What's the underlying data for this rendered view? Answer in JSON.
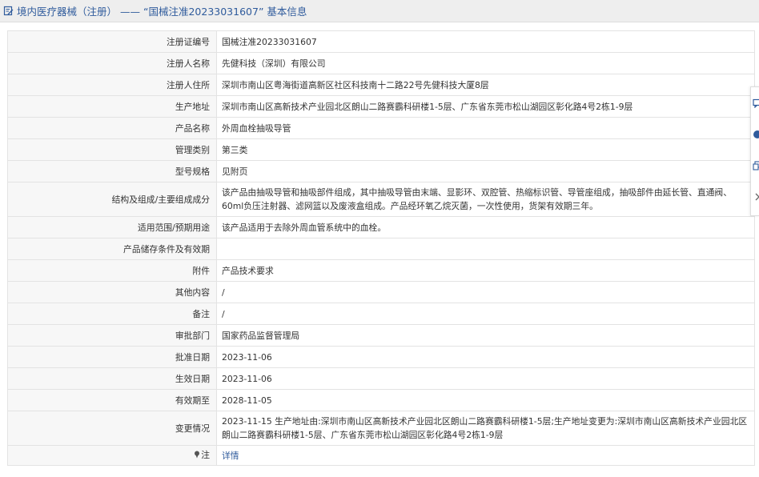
{
  "header": {
    "section": "境内医疗器械（注册）",
    "separator": "——",
    "record_title": "“国械注准20233031607” 基本信息"
  },
  "rows": [
    {
      "label": "注册证编号",
      "value": "国械注准20233031607"
    },
    {
      "label": "注册人名称",
      "value": "先健科技（深圳）有限公司"
    },
    {
      "label": "注册人住所",
      "value": "深圳市南山区粤海街道高新区社区科技南十二路22号先健科技大厦8层"
    },
    {
      "label": "生产地址",
      "value": "深圳市南山区高新技术产业园北区朗山二路赛霸科研楼1-5层、广东省东莞市松山湖园区彰化路4号2栋1-9层"
    },
    {
      "label": "产品名称",
      "value": "外周血栓抽吸导管"
    },
    {
      "label": "管理类别",
      "value": "第三类"
    },
    {
      "label": "型号规格",
      "value": "见附页"
    },
    {
      "label": "结构及组成/主要组成成分",
      "value": "该产品由抽吸导管和抽吸部件组成，其中抽吸导管由末端、显影环、双腔管、热缩标识管、导管座组成，抽吸部件由延长管、直通阀、60ml负压注射器、滤网篮以及废液盒组成。产品经环氧乙烷灭菌，一次性使用，货架有效期三年。"
    },
    {
      "label": "适用范围/预期用途",
      "value": "该产品适用于去除外周血管系统中的血栓。"
    },
    {
      "label": "产品储存条件及有效期",
      "value": ""
    },
    {
      "label": "附件",
      "value": "产品技术要求"
    },
    {
      "label": "其他内容",
      "value": "/"
    },
    {
      "label": "备注",
      "value": "/"
    },
    {
      "label": "审批部门",
      "value": "国家药品监督管理局"
    },
    {
      "label": "批准日期",
      "value": "2023-11-06"
    },
    {
      "label": "生效日期",
      "value": "2023-11-06"
    },
    {
      "label": "有效期至",
      "value": "2028-11-05"
    },
    {
      "label": "变更情况",
      "value": "2023-11-15 生产地址由:深圳市南山区高新技术产业园北区朗山二路赛霸科研楼1-5层;生产地址变更为:深圳市南山区高新技术产业园北区朗山二路赛霸科研楼1-5层、广东省东莞市松山湖园区彰化路4号2栋1-9层"
    }
  ],
  "note_row": {
    "label": "注",
    "link_text": "详情"
  },
  "colors": {
    "title_blue": "#2f5b9c",
    "label_bg": "#f7f7f7",
    "border": "#e3e3e3"
  },
  "icons": [
    "edit-icon",
    "pin-icon",
    "message-icon",
    "copy-icon",
    "chevron-right-icon"
  ]
}
